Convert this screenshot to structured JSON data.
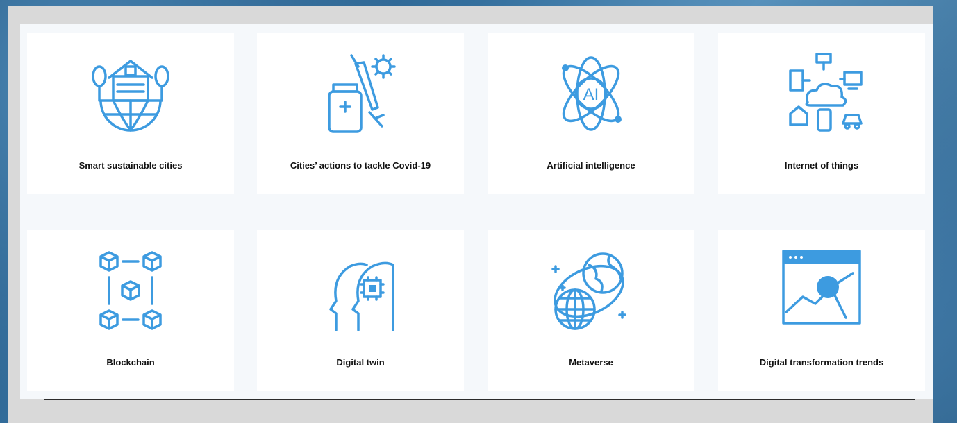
{
  "colors": {
    "accent": "#3d9be0",
    "panel": "#f5f8fb",
    "frame": "#d9d9d9"
  },
  "cards": [
    {
      "label": "Smart sustainable cities",
      "icon": "smart-city-icon"
    },
    {
      "label": "Cities’ actions to tackle Covid-19",
      "icon": "vaccine-icon"
    },
    {
      "label": "Artificial intelligence",
      "icon": "ai-atom-icon"
    },
    {
      "label": "Internet of things",
      "icon": "iot-cloud-icon"
    },
    {
      "label": "Blockchain",
      "icon": "blockchain-icon"
    },
    {
      "label": "Digital twin",
      "icon": "digital-twin-icon"
    },
    {
      "label": "Metaverse",
      "icon": "metaverse-globes-icon"
    },
    {
      "label": "Digital transformation trends",
      "icon": "trends-search-icon"
    }
  ]
}
